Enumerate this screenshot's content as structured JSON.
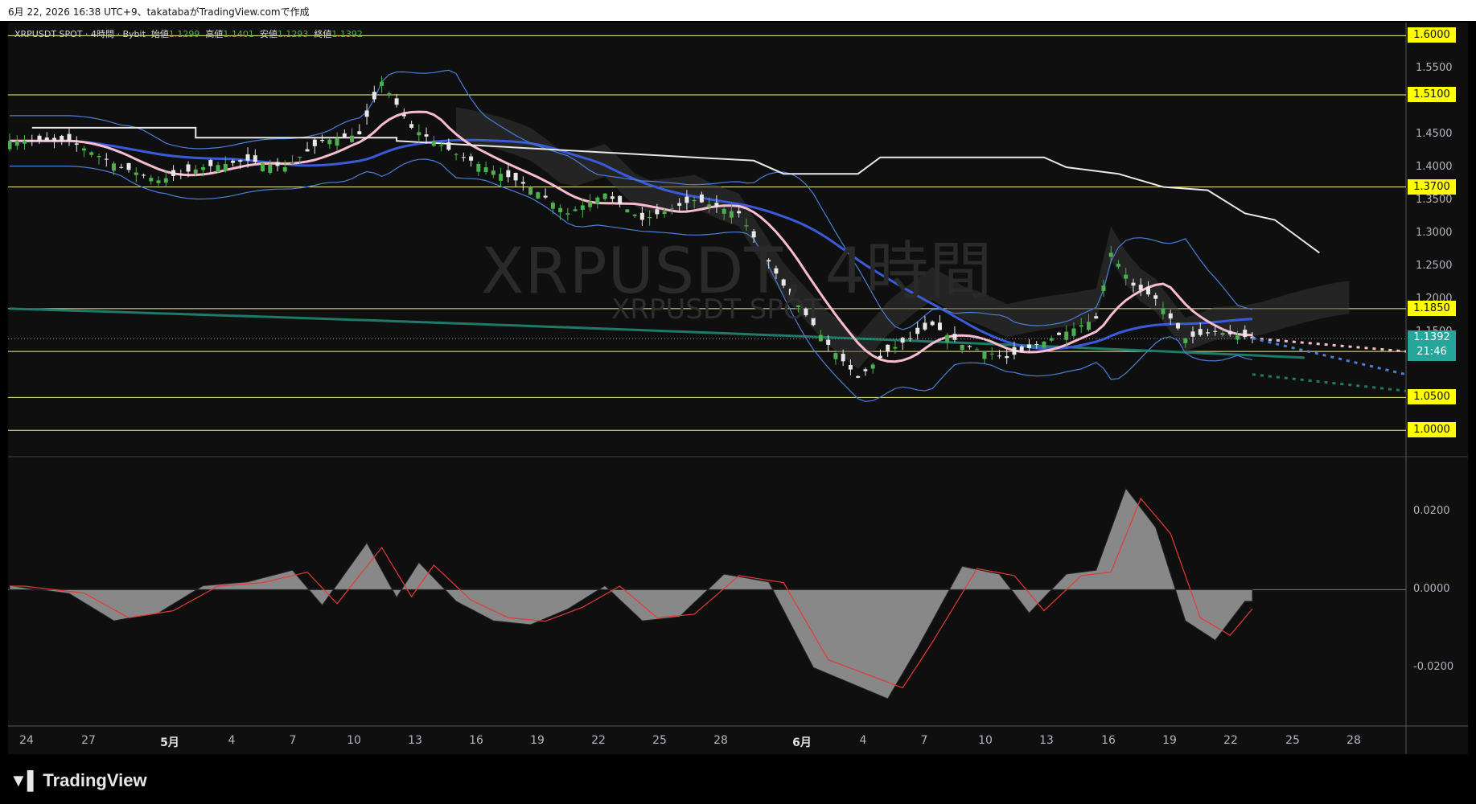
{
  "header": {
    "text": "6月 22, 2026 16:38 UTC+9、takatabaがTradingView.comで作成"
  },
  "legend": {
    "symbol": "XRPUSDT SPOT · 4時間 · Bybit",
    "open_label": "始値",
    "open": "1.1299",
    "high_label": "高値",
    "high": "1.1401",
    "low_label": "安値",
    "low": "1.1293",
    "close_label": "終値",
    "close": "1.1392"
  },
  "watermark": {
    "line1": "XRPUSDT, 4時間",
    "line2": "XRPUSDT SPOT"
  },
  "price_axis": {
    "ticks": [
      "1.5500",
      "1.4500",
      "1.4000",
      "1.3500",
      "1.3000",
      "1.2500",
      "1.2000",
      "1.1500"
    ],
    "tagged_levels": [
      "1.6000",
      "1.5100",
      "1.3700",
      "1.1850",
      "1.1200",
      "1.0500",
      "1.0000"
    ],
    "current_price": "1.1392",
    "countdown": "21:46"
  },
  "oscillator_axis": {
    "ticks": [
      "0.0200",
      "0.0000",
      "-0.0200"
    ]
  },
  "time_axis": {
    "labels": [
      "24",
      "27",
      "5月",
      "4",
      "7",
      "10",
      "13",
      "16",
      "19",
      "22",
      "25",
      "28",
      "6月",
      "4",
      "7",
      "10",
      "13",
      "16",
      "19",
      "22",
      "25",
      "28"
    ],
    "bold": [
      "5月",
      "6月"
    ]
  },
  "footer": {
    "brand": "TradingView"
  },
  "colors": {
    "level_line": "#f5f08a",
    "tag_bg": "#ffff00",
    "up": "#4caf50",
    "down": "#e8e8e8",
    "ma_fast": "#f8bbd0",
    "ma_slow": "#3a5bd9",
    "ma_long": "#1f7a68",
    "bollinger": "#4a7fd8",
    "trend_white": "#e8e8e8",
    "oscillator_fill": "#888888",
    "signal": "#e53935"
  },
  "chart_data": {
    "type": "candlestick",
    "symbol": "XRPUSDT SPOT",
    "interval": "4時間",
    "exchange": "Bybit",
    "ylim": [
      0.96,
      1.62
    ],
    "horizontal_levels": [
      1.6,
      1.51,
      1.37,
      1.185,
      1.12,
      1.05,
      1.0
    ],
    "price_path": [
      [
        0,
        1.44
      ],
      [
        8,
        1.44
      ],
      [
        15,
        1.4
      ],
      [
        20,
        1.38
      ],
      [
        26,
        1.4
      ],
      [
        32,
        1.41
      ],
      [
        37,
        1.4
      ],
      [
        42,
        1.44
      ],
      [
        47,
        1.45
      ],
      [
        50,
        1.53
      ],
      [
        54,
        1.46
      ],
      [
        60,
        1.42
      ],
      [
        66,
        1.39
      ],
      [
        70,
        1.37
      ],
      [
        75,
        1.33
      ],
      [
        80,
        1.36
      ],
      [
        85,
        1.32
      ],
      [
        92,
        1.35
      ],
      [
        98,
        1.33
      ],
      [
        104,
        1.22
      ],
      [
        110,
        1.13
      ],
      [
        114,
        1.08
      ],
      [
        118,
        1.12
      ],
      [
        124,
        1.16
      ],
      [
        128,
        1.13
      ],
      [
        134,
        1.11
      ],
      [
        140,
        1.14
      ],
      [
        146,
        1.17
      ],
      [
        148,
        1.27
      ],
      [
        151,
        1.22
      ],
      [
        154,
        1.2
      ],
      [
        158,
        1.14
      ],
      [
        162,
        1.15
      ],
      [
        167,
        1.14
      ]
    ],
    "oscillator": {
      "ylim": [
        -0.035,
        0.03
      ],
      "histogram_path": [
        [
          0,
          0.001
        ],
        [
          8,
          -0.001
        ],
        [
          14,
          -0.008
        ],
        [
          20,
          -0.006
        ],
        [
          26,
          0.001
        ],
        [
          32,
          0.002
        ],
        [
          38,
          0.005
        ],
        [
          42,
          -0.004
        ],
        [
          48,
          0.012
        ],
        [
          52,
          -0.002
        ],
        [
          55,
          0.007
        ],
        [
          60,
          -0.003
        ],
        [
          65,
          -0.008
        ],
        [
          70,
          -0.009
        ],
        [
          75,
          -0.005
        ],
        [
          80,
          0.001
        ],
        [
          85,
          -0.008
        ],
        [
          90,
          -0.007
        ],
        [
          96,
          0.004
        ],
        [
          102,
          0.002
        ],
        [
          108,
          -0.02
        ],
        [
          113,
          -0.024
        ],
        [
          118,
          -0.028
        ],
        [
          122,
          -0.015
        ],
        [
          128,
          0.006
        ],
        [
          133,
          0.004
        ],
        [
          137,
          -0.006
        ],
        [
          142,
          0.004
        ],
        [
          146,
          0.005
        ],
        [
          150,
          0.026
        ],
        [
          154,
          0.016
        ],
        [
          158,
          -0.008
        ],
        [
          162,
          -0.013
        ],
        [
          166,
          -0.003
        ],
        [
          167,
          -0.003
        ]
      ]
    }
  }
}
